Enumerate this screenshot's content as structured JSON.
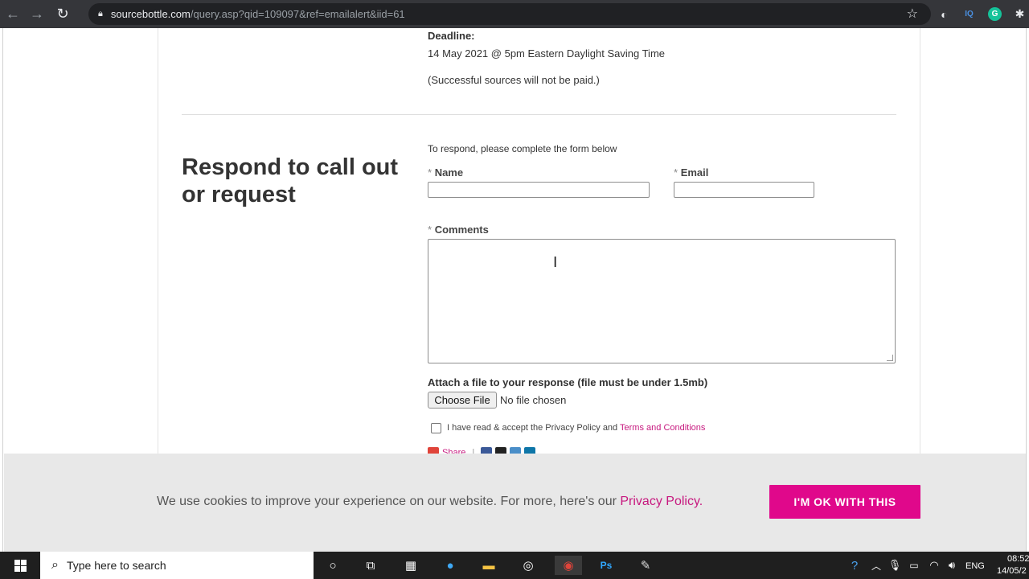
{
  "browser": {
    "url_host": "sourcebottle.com",
    "url_path": "/query.asp?qid=109097&ref=emailalert&iid=61",
    "icons": [
      "back-icon",
      "forward-icon",
      "reload-icon",
      "lock-icon",
      "star-icon"
    ],
    "extensions": [
      {
        "name": "extension-halo-icon",
        "glyph": "◐",
        "color": "#e8eaed"
      },
      {
        "name": "extension-iq-icon",
        "glyph": "IQ",
        "color": "#4a90e2"
      },
      {
        "name": "extension-grammarly-icon",
        "glyph": "G",
        "color": "#15c39a"
      },
      {
        "name": "extensions-puzzle-icon",
        "glyph": "✱",
        "color": "#e8eaed"
      }
    ]
  },
  "query": {
    "deadline_label": "Deadline:",
    "deadline_value": "14 May 2021 @ 5pm Eastern Daylight Saving Time",
    "paid_note": "(Successful sources will not be paid.)"
  },
  "form": {
    "heading": "Respond to call out or request",
    "intro": "To respond, please complete the form below",
    "required_mark": "*",
    "name_label": "Name",
    "email_label": "Email",
    "comments_label": "Comments",
    "name_value": "",
    "email_value": "",
    "comments_value": "",
    "attach_label": "Attach a file to your response (file must be under 1.5mb)",
    "choose_file_label": "Choose File",
    "no_file_text": "No file chosen",
    "terms_text": "I have read & accept the Privacy Policy and",
    "terms_link": "Terms and Conditions",
    "terms_checked": false,
    "share_label": "Share"
  },
  "cookie": {
    "text": "We use cookies to improve your experience on our website. For more, here's our",
    "link": "Privacy Policy.",
    "button": "I'M OK WITH THIS"
  },
  "taskbar": {
    "search_placeholder": "Type here to search",
    "apps": [
      "cortana-icon",
      "task-view-icon",
      "calculator-icon",
      "edge-icon",
      "file-explorer-icon",
      "obs-icon",
      "chrome-icon",
      "photoshop-icon",
      "paint-icon"
    ],
    "lang": "ENG",
    "time": "08:52",
    "date": "14/05/2"
  },
  "colors": {
    "accent": "#e0088b",
    "link": "#c7197f",
    "chrome_dark": "#35363a"
  }
}
